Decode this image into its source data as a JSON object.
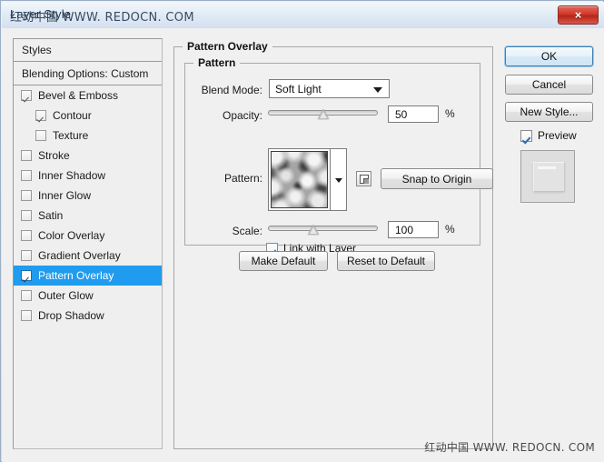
{
  "window": {
    "title": "Layer Style",
    "watermark": "红动中国 WWW. REDOCN. COM",
    "close_icon": "×"
  },
  "styles_panel": {
    "header": "Styles",
    "blending_options": "Blending Options: Custom",
    "items": [
      {
        "label": "Bevel & Emboss",
        "checked": true,
        "indent": false,
        "selected": false
      },
      {
        "label": "Contour",
        "checked": true,
        "indent": true,
        "selected": false
      },
      {
        "label": "Texture",
        "checked": false,
        "indent": true,
        "selected": false
      },
      {
        "label": "Stroke",
        "checked": false,
        "indent": false,
        "selected": false
      },
      {
        "label": "Inner Shadow",
        "checked": false,
        "indent": false,
        "selected": false
      },
      {
        "label": "Inner Glow",
        "checked": false,
        "indent": false,
        "selected": false
      },
      {
        "label": "Satin",
        "checked": false,
        "indent": false,
        "selected": false
      },
      {
        "label": "Color Overlay",
        "checked": false,
        "indent": false,
        "selected": false
      },
      {
        "label": "Gradient Overlay",
        "checked": false,
        "indent": false,
        "selected": false
      },
      {
        "label": "Pattern Overlay",
        "checked": true,
        "indent": false,
        "selected": true
      },
      {
        "label": "Outer Glow",
        "checked": false,
        "indent": false,
        "selected": false
      },
      {
        "label": "Drop Shadow",
        "checked": false,
        "indent": false,
        "selected": false
      }
    ]
  },
  "main": {
    "group_title": "Pattern Overlay",
    "subgroup_title": "Pattern",
    "blend_mode": {
      "label": "Blend Mode:",
      "value": "Soft Light"
    },
    "opacity": {
      "label": "Opacity:",
      "value": "50",
      "unit": "%",
      "percent": 50
    },
    "pattern": {
      "label": "Pattern:",
      "snap_button": "Snap to Origin",
      "new_pattern_icon": "new-pattern-icon"
    },
    "scale": {
      "label": "Scale:",
      "value": "100",
      "unit": "%",
      "percent": 40
    },
    "link_with_layer": {
      "label": "Link with Layer",
      "checked": true
    },
    "make_default": "Make Default",
    "reset_to_default": "Reset to Default"
  },
  "right": {
    "ok": "OK",
    "cancel": "Cancel",
    "new_style": "New Style...",
    "preview": {
      "label": "Preview",
      "checked": true
    }
  },
  "colors": {
    "selection_blue": "#1f9cf0",
    "close_red": "#d0392c",
    "dialog_bg": "#f0f0f0"
  }
}
